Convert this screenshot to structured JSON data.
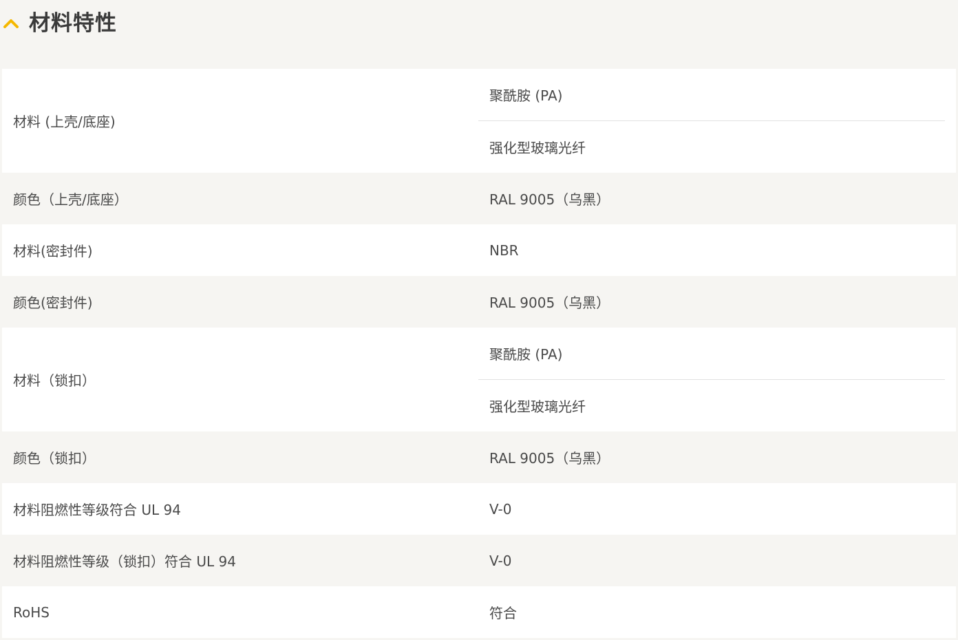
{
  "section": {
    "title": "材料特性",
    "toggle_icon": "chevron-up-icon",
    "accent_color": "#f5b800"
  },
  "rows": [
    {
      "label": "材料 (上壳/底座)",
      "values": [
        "聚酰胺 (PA)",
        "强化型玻璃光纤"
      ]
    },
    {
      "label": "颜色（上壳/底座）",
      "values": [
        "RAL 9005（乌黑）"
      ]
    },
    {
      "label": "材料(密封件)",
      "values": [
        "NBR"
      ]
    },
    {
      "label": "颜色(密封件)",
      "values": [
        "RAL 9005（乌黑）"
      ]
    },
    {
      "label": "材料（锁扣）",
      "values": [
        "聚酰胺 (PA)",
        "强化型玻璃光纤"
      ]
    },
    {
      "label": "颜色（锁扣）",
      "values": [
        "RAL 9005（乌黑）"
      ]
    },
    {
      "label": "材料阻燃性等级符合 UL 94",
      "values": [
        "V-0"
      ]
    },
    {
      "label": "材料阻燃性等级（锁扣）符合 UL 94",
      "values": [
        "V-0"
      ]
    },
    {
      "label": "RoHS",
      "values": [
        "符合"
      ]
    }
  ]
}
